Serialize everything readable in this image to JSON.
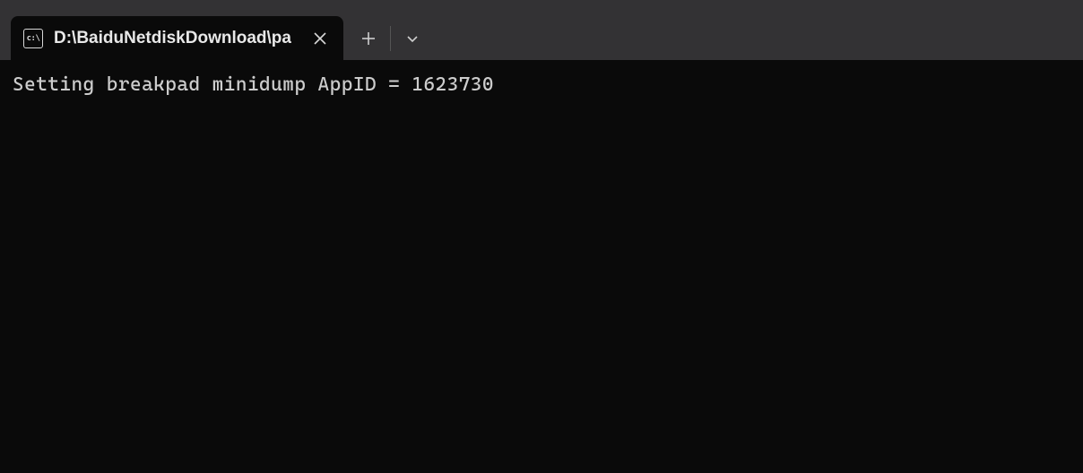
{
  "tab": {
    "title": "D:\\BaiduNetdiskDownload\\pa",
    "icon_label": "c:\\"
  },
  "terminal": {
    "line1": "Setting breakpad minidump AppID = 1623730"
  }
}
